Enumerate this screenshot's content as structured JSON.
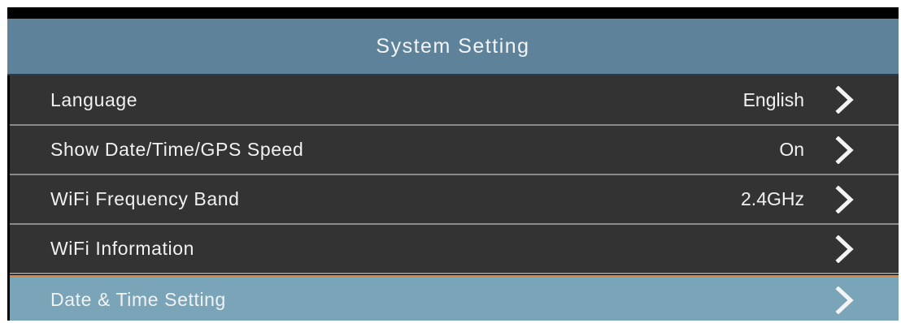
{
  "header": {
    "title": "System Setting"
  },
  "menu": {
    "items": [
      {
        "label": "Language",
        "value": "English",
        "icon": "chevron-right-icon",
        "selected": false
      },
      {
        "label": "Show Date/Time/GPS Speed",
        "value": "On",
        "icon": "chevron-right-icon",
        "selected": false
      },
      {
        "label": "WiFi Frequency Band",
        "value": "2.4GHz",
        "icon": "chevron-right-icon",
        "selected": false
      },
      {
        "label": "WiFi Information",
        "value": "",
        "icon": "chevron-right-icon",
        "selected": false
      },
      {
        "label": "Date & Time Setting",
        "value": "",
        "icon": "chevron-right-icon",
        "selected": true
      }
    ]
  },
  "colors": {
    "header_bg": "#5e8299",
    "row_bg": "#333333",
    "selected_bg": "#7aa5b9",
    "selected_accent": "#d28a4a",
    "text": "#f1f1f1"
  }
}
